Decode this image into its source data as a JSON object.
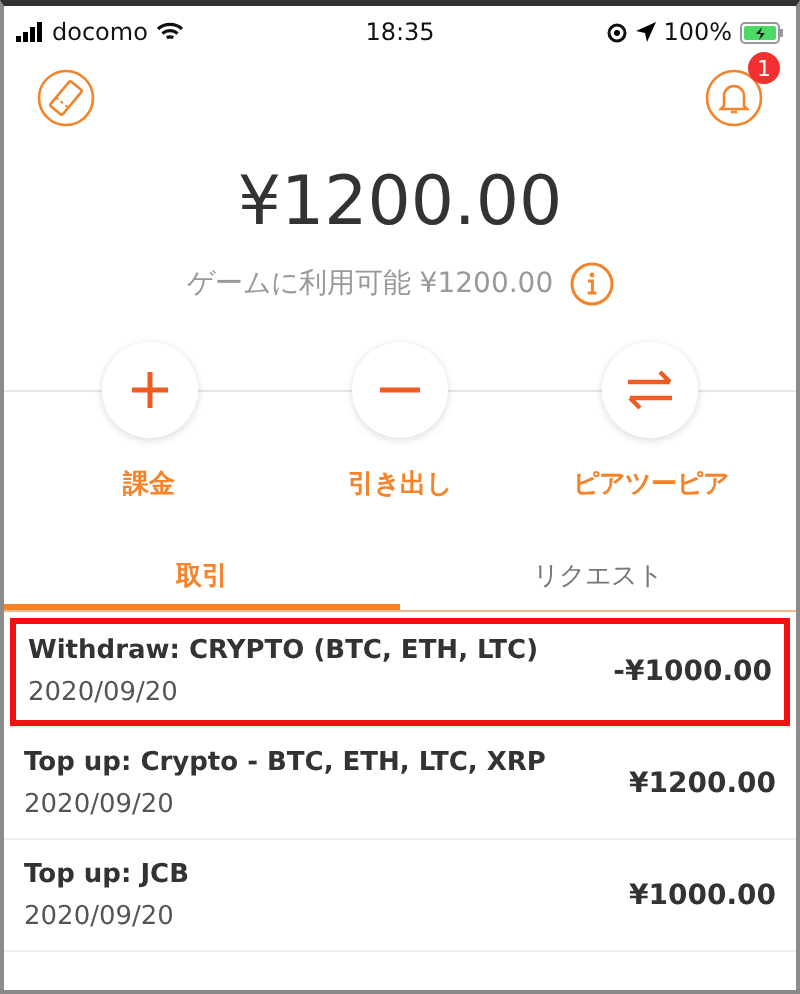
{
  "status_bar": {
    "carrier": "docomo",
    "time": "18:35",
    "battery": "100%"
  },
  "header": {
    "notification_count": "1"
  },
  "balance": {
    "amount": "¥1200.00",
    "available_label": "ゲームに利用可能 ¥1200.00"
  },
  "actions": [
    {
      "kind": "plus",
      "label": "課金"
    },
    {
      "kind": "minus",
      "label": "引き出し"
    },
    {
      "kind": "swap",
      "label": "ピアツーピア"
    }
  ],
  "tabs": [
    {
      "label": "取引",
      "selected": true
    },
    {
      "label": "リクエスト",
      "selected": false
    }
  ],
  "transactions": [
    {
      "title": "Withdraw: CRYPTO (BTC, ETH, LTC)",
      "date": "2020/09/20",
      "amount": "-¥1000.00",
      "highlighted": true
    },
    {
      "title": "Top up: Crypto - BTC, ETH, LTC, XRP",
      "date": "2020/09/20",
      "amount": "¥1200.00",
      "highlighted": false
    },
    {
      "title": "Top up: JCB",
      "date": "2020/09/20",
      "amount": "¥1000.00",
      "highlighted": false
    }
  ]
}
